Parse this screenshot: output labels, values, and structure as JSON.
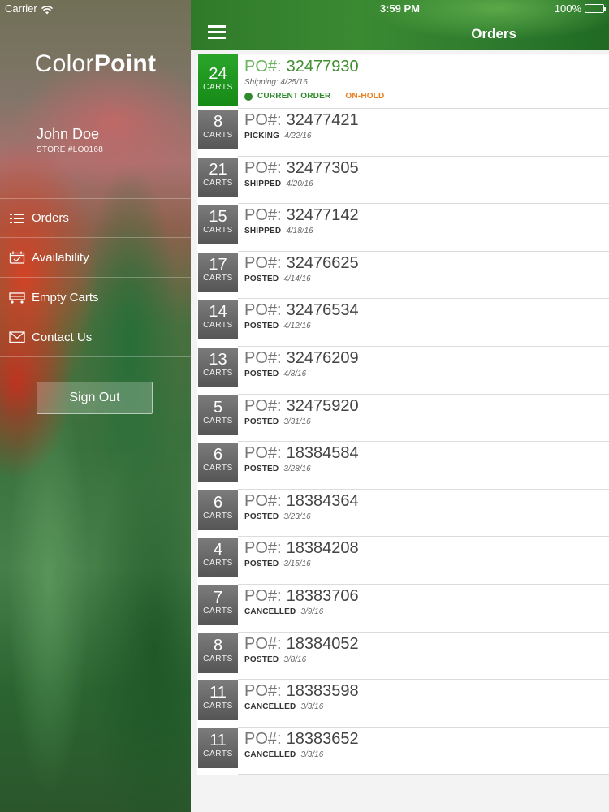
{
  "status_bar": {
    "carrier": "Carrier",
    "time": "3:59 PM",
    "battery": "100%"
  },
  "drawer": {
    "logo_light": "Color",
    "logo_bold": "Point",
    "user_name": "John Doe",
    "store_id": "STORE #LO0168",
    "menu": [
      {
        "label": "Orders",
        "icon": "list-icon"
      },
      {
        "label": "Availability",
        "icon": "calendar-check-icon"
      },
      {
        "label": "Empty Carts",
        "icon": "cart-icon"
      },
      {
        "label": "Contact Us",
        "icon": "envelope-icon"
      }
    ],
    "sign_out": "Sign Out"
  },
  "header": {
    "title": "Orders"
  },
  "orders": {
    "po_label": "PO#:",
    "carts_label": "CARTS",
    "current": {
      "carts": "24",
      "po": "32477930",
      "shipping": "Shipping: 4/25/16",
      "current_label": "CURRENT ORDER",
      "hold_label": "ON-HOLD"
    },
    "items": [
      {
        "carts": "8",
        "po": "32477421",
        "status": "PICKING",
        "date": "4/22/16"
      },
      {
        "carts": "21",
        "po": "32477305",
        "status": "SHIPPED",
        "date": "4/20/16"
      },
      {
        "carts": "15",
        "po": "32477142",
        "status": "SHIPPED",
        "date": "4/18/16"
      },
      {
        "carts": "17",
        "po": "32476625",
        "status": "POSTED",
        "date": "4/14/16"
      },
      {
        "carts": "14",
        "po": "32476534",
        "status": "POSTED",
        "date": "4/12/16"
      },
      {
        "carts": "13",
        "po": "32476209",
        "status": "POSTED",
        "date": "4/8/16"
      },
      {
        "carts": "5",
        "po": "32475920",
        "status": "POSTED",
        "date": "3/31/16"
      },
      {
        "carts": "6",
        "po": "18384584",
        "status": "POSTED",
        "date": "3/28/16"
      },
      {
        "carts": "6",
        "po": "18384364",
        "status": "POSTED",
        "date": "3/23/16"
      },
      {
        "carts": "4",
        "po": "18384208",
        "status": "POSTED",
        "date": "3/15/16"
      },
      {
        "carts": "7",
        "po": "18383706",
        "status": "CANCELLED",
        "date": "3/9/16"
      },
      {
        "carts": "8",
        "po": "18384052",
        "status": "POSTED",
        "date": "3/8/16"
      },
      {
        "carts": "11",
        "po": "18383598",
        "status": "CANCELLED",
        "date": "3/3/16"
      },
      {
        "carts": "11",
        "po": "18383652",
        "status": "CANCELLED",
        "date": "3/3/16"
      }
    ]
  },
  "colors": {
    "brand_green": "#2f8a2c",
    "hold_orange": "#e8801e",
    "cart_gray": "#555555"
  }
}
